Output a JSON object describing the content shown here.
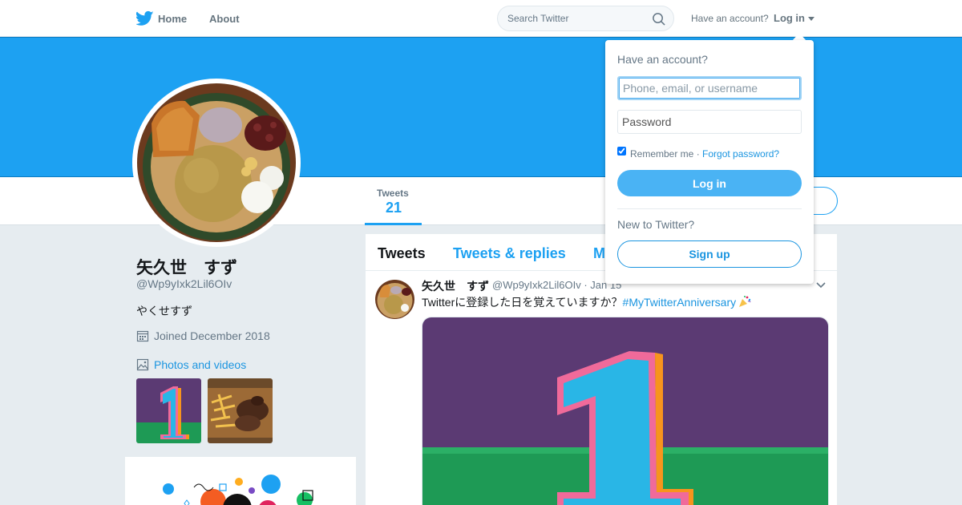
{
  "nav": {
    "home_label": "Home",
    "about_label": "About",
    "search_placeholder": "Search Twitter",
    "have_account": "Have an account?",
    "login_label": "Log in",
    "brand_color": "#1da1f2"
  },
  "profile": {
    "display_name": "矢久世　すず",
    "handle": "@Wp9yIxk2Lil6OIv",
    "bio": "やくせすず",
    "joined": "Joined December 2018",
    "photos_label": "Photos and videos"
  },
  "stats": {
    "tweets_label": "Tweets",
    "tweets_value": "21"
  },
  "timeline": {
    "tabs": [
      {
        "label": "Tweets"
      },
      {
        "label": "Tweets & replies"
      },
      {
        "label": "M"
      }
    ],
    "tweet": {
      "name": "矢久世　すず",
      "handle_date": "@Wp9yIxk2Lil6OIv · Jan 15",
      "text": "Twitterに登録した日を覚えていますか？",
      "hashtag": "#MyTwitterAnniversary"
    }
  },
  "login_dropdown": {
    "title": "Have an account?",
    "username_placeholder": "Phone, email, or username",
    "password_placeholder": "Password",
    "remember_label": "Remember me",
    "forgot_label": "Forgot password?",
    "login_button": "Log in",
    "new_label": "New to Twitter?",
    "signup_button": "Sign up"
  }
}
